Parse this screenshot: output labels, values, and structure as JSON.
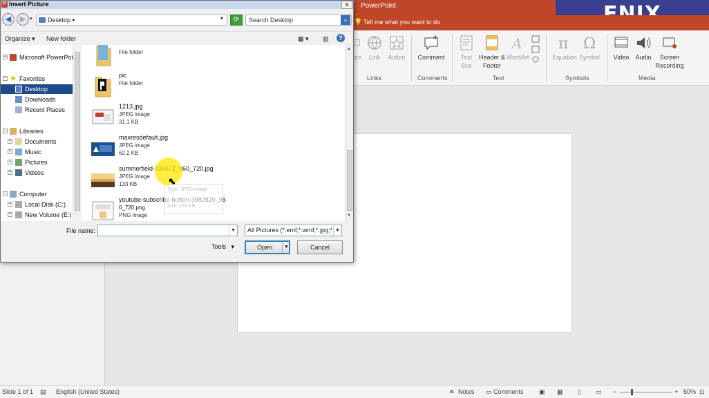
{
  "powerpoint": {
    "app_title": "PowerPoint",
    "watermark": "ENIX Tutorials",
    "tell_me": "Tell me what you want to do",
    "ribbon": {
      "buttons": [
        {
          "label": "om",
          "dim": true
        },
        {
          "label": "Link",
          "dim": true
        },
        {
          "label": "Action",
          "dim": true
        },
        {
          "label": "Comment",
          "dim": false
        },
        {
          "label": "Text Box",
          "dim": true
        },
        {
          "label": "Header & Footer",
          "dim": false
        },
        {
          "label": "WordArt",
          "dim": true
        },
        {
          "label": "Equation",
          "dim": true
        },
        {
          "label": "Symbol",
          "dim": true
        },
        {
          "label": "Video",
          "dim": false
        },
        {
          "label": "Audio",
          "dim": false
        },
        {
          "label": "Screen Recording",
          "dim": false
        }
      ],
      "groups": [
        "Links",
        "Comments",
        "Text",
        "Symbols",
        "Media"
      ]
    },
    "status": {
      "slide": "Slide 1 of 1",
      "language": "English (United States)",
      "notes": "Notes",
      "comments": "Comments",
      "zoom": "50%"
    }
  },
  "dialog": {
    "title": "Insert Picture",
    "close_label": "✕",
    "address": "Desktop",
    "search_placeholder": "Search Desktop",
    "toolbar": {
      "organize": "Organize",
      "new_folder": "New folder"
    },
    "nav": [
      {
        "label": "Microsoft PowerPoint",
        "expander": "+",
        "selected": false
      },
      {
        "label": "Favorites",
        "expander": "−",
        "selected": false
      },
      {
        "label": "Desktop",
        "expander": "",
        "selected": true
      },
      {
        "label": "Downloads",
        "expander": "",
        "selected": false
      },
      {
        "label": "Recent Places",
        "expander": "",
        "selected": false
      },
      {
        "label": "Libraries",
        "expander": "−",
        "selected": false
      },
      {
        "label": "Documents",
        "expander": "+",
        "selected": false
      },
      {
        "label": "Music",
        "expander": "+",
        "selected": false
      },
      {
        "label": "Pictures",
        "expander": "+",
        "selected": false
      },
      {
        "label": "Videos",
        "expander": "+",
        "selected": false
      },
      {
        "label": "Computer",
        "expander": "−",
        "selected": false
      },
      {
        "label": "Local Disk (C:)",
        "expander": "+",
        "selected": false
      },
      {
        "label": "New Volume (E:)",
        "expander": "+",
        "selected": false
      }
    ],
    "files": [
      {
        "name": "",
        "type": "File folder",
        "size": "",
        "icon": "folder-icon"
      },
      {
        "name": "pic",
        "type": "File folder",
        "size": "",
        "icon": "folder-icon"
      },
      {
        "name": "1213.jpg",
        "type": "JPEG image",
        "size": "31.1 KB",
        "icon": "image-icon"
      },
      {
        "name": "maxresdefault.jpg",
        "type": "JPEG image",
        "size": "62.2 KB",
        "icon": "image-icon"
      },
      {
        "name": "summerfield-336672_960_720.jpg",
        "type": "JPEG image",
        "size": "133 KB",
        "icon": "image-icon"
      },
      {
        "name": "youtube-subscribe-button-3682820_96",
        "name2": "0_720.png",
        "type": "PNG image",
        "size": "",
        "icon": "image-icon"
      }
    ],
    "tooltip": {
      "line1": "Type: JPEG image",
      "line2": "Size: 133 KB"
    },
    "filename_label": "File name:",
    "filename_value": "",
    "filter": "All Pictures (*.emf;*.wmf;*.jpg;*",
    "tools": "Tools",
    "open": "Open",
    "cancel": "Cancel"
  },
  "colors": {
    "accent": "#c0462a",
    "selection": "#1e4a8c",
    "cursor_highlight": "#ffe800"
  }
}
